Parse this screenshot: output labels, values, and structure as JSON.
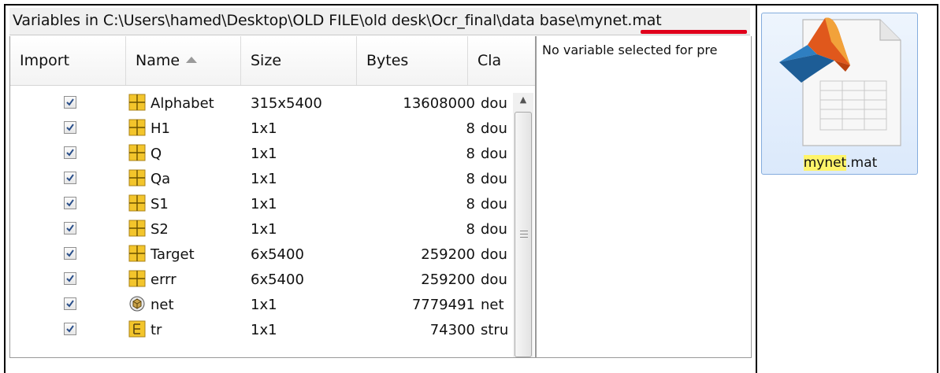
{
  "window": {
    "title_prefix": "Variables in C:\\Users\\hamed\\Desktop\\OLD FILE\\old desk\\Ocr_final\\data base\\",
    "title_file": "mynet.mat"
  },
  "table": {
    "columns": {
      "import": "Import",
      "name": "Name",
      "size": "Size",
      "bytes": "Bytes",
      "class": "Cla"
    },
    "sort_indicator": "ascending",
    "rows": [
      {
        "checked": true,
        "icon": "matrix-icon",
        "name": "Alphabet",
        "size": "315x5400",
        "bytes": "13608000",
        "class": "dou"
      },
      {
        "checked": true,
        "icon": "matrix-icon",
        "name": "H1",
        "size": "1x1",
        "bytes": "8",
        "class": "dou"
      },
      {
        "checked": true,
        "icon": "matrix-icon",
        "name": "Q",
        "size": "1x1",
        "bytes": "8",
        "class": "dou"
      },
      {
        "checked": true,
        "icon": "matrix-icon",
        "name": "Qa",
        "size": "1x1",
        "bytes": "8",
        "class": "dou"
      },
      {
        "checked": true,
        "icon": "matrix-icon",
        "name": "S1",
        "size": "1x1",
        "bytes": "8",
        "class": "dou"
      },
      {
        "checked": true,
        "icon": "matrix-icon",
        "name": "S2",
        "size": "1x1",
        "bytes": "8",
        "class": "dou"
      },
      {
        "checked": true,
        "icon": "matrix-icon",
        "name": "Target",
        "size": "6x5400",
        "bytes": "259200",
        "class": "dou"
      },
      {
        "checked": true,
        "icon": "matrix-icon",
        "name": "errr",
        "size": "6x5400",
        "bytes": "259200",
        "class": "dou"
      },
      {
        "checked": true,
        "icon": "object-icon",
        "name": "net",
        "size": "1x1",
        "bytes": "7779491",
        "class": "net"
      },
      {
        "checked": true,
        "icon": "struct-icon",
        "name": "tr",
        "size": "1x1",
        "bytes": "74300",
        "class": "stru"
      }
    ]
  },
  "preview": {
    "message": "No variable selected for pre"
  },
  "file_icon": {
    "icon": "matlab-file-icon",
    "name_highlight": "mynet",
    "extension": ".mat"
  },
  "colors": {
    "underline": "#e0001b",
    "highlight": "#fff46a",
    "selection_border": "#84acdd"
  }
}
